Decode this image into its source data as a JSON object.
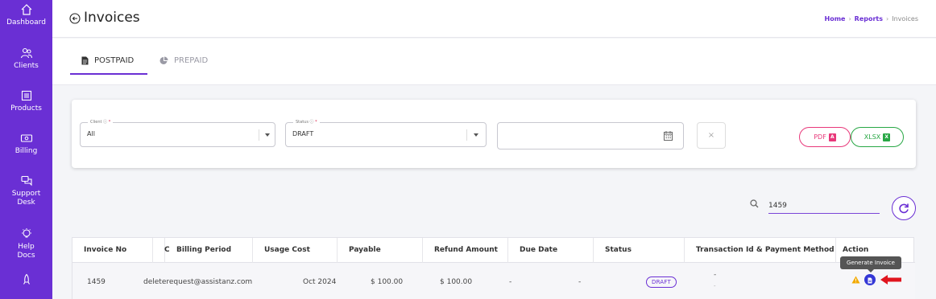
{
  "sidebar": {
    "items": [
      {
        "label": "Dashboard",
        "icon": "home-icon"
      },
      {
        "label": "Clients",
        "icon": "users-icon"
      },
      {
        "label": "Products",
        "icon": "products-icon"
      },
      {
        "label": "Billing",
        "icon": "billing-icon"
      },
      {
        "label": "Support",
        "label2": "Desk",
        "icon": "chat-icon"
      },
      {
        "label": "Help",
        "label2": "Docs",
        "icon": "lightbulb-icon"
      },
      {
        "label": "",
        "icon": "rocket-icon"
      }
    ],
    "bg_color": "#6a2fd4"
  },
  "header": {
    "title": "Invoices",
    "breadcrumb": [
      "Home",
      "Reports",
      "Invoices"
    ]
  },
  "tabs": [
    {
      "label": "POSTPAID",
      "active": true,
      "icon": "document-icon"
    },
    {
      "label": "PREPAID",
      "active": false,
      "icon": "pie-chart-icon"
    }
  ],
  "filters": {
    "client": {
      "label": "Client",
      "required_mark": "*",
      "value": "All"
    },
    "status": {
      "label": "Status",
      "required_mark": "*",
      "value": "DRAFT"
    },
    "date": {
      "value": ""
    },
    "clear_label": "×",
    "pdf_label": "PDF",
    "xlsx_label": "XLSX"
  },
  "search": {
    "value": "1459"
  },
  "table": {
    "columns": [
      "Invoice No",
      "C",
      "Billing Period",
      "Usage Cost",
      "Payable",
      "Refund Amount",
      "Due Date",
      "Status",
      "Transaction Id & Payment Method",
      "Action"
    ],
    "rows": [
      {
        "invoice_no": "1459",
        "client": "deleterequest@assistanz.com",
        "billing_period": "Oct 2024",
        "usage_cost": "$ 100.00",
        "payable": "$ 100.00",
        "refund_amount": "-",
        "due_date": "-",
        "status": "DRAFT",
        "transaction": "-",
        "payment_method": "-"
      }
    ]
  },
  "tooltip": "Generate Invoice",
  "colors": {
    "accent": "#6a2fd4",
    "pdf": "#e8387a",
    "xlsx": "#28a745",
    "arrow": "#e0141e",
    "warn": "#f2a900"
  }
}
